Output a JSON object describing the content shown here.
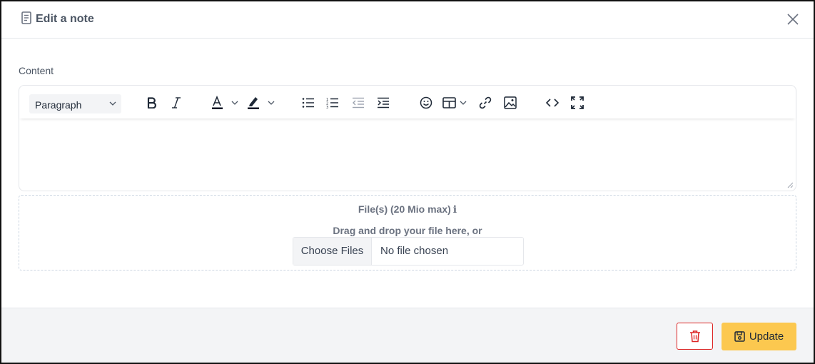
{
  "modal": {
    "title": "Edit a note",
    "title_icon": "note-icon",
    "close_icon": "close-icon"
  },
  "content_field": {
    "label": "Content",
    "editor_value": ""
  },
  "toolbar": {
    "block_format": "Paragraph",
    "buttons": [
      {
        "name": "bold-icon"
      },
      {
        "name": "italic-icon"
      },
      {
        "name": "text-color-icon"
      },
      {
        "name": "highlight-color-icon"
      },
      {
        "name": "bullet-list-icon"
      },
      {
        "name": "numbered-list-icon"
      },
      {
        "name": "outdent-icon"
      },
      {
        "name": "indent-icon"
      },
      {
        "name": "emoji-icon"
      },
      {
        "name": "table-icon"
      },
      {
        "name": "link-icon"
      },
      {
        "name": "image-icon"
      },
      {
        "name": "code-view-icon"
      },
      {
        "name": "fullscreen-icon"
      }
    ]
  },
  "upload": {
    "title": "File(s) (20 Mio max)",
    "info_icon": "i",
    "hint": "Drag and drop your file here, or",
    "choose_button": "Choose Files",
    "status": "No file chosen"
  },
  "footer": {
    "delete_icon": "trash-icon",
    "update_label": "Update",
    "update_icon": "save-icon"
  },
  "colors": {
    "update_bg": "#fcc84f",
    "delete_border": "#dc2626",
    "footer_bg": "#f3f4f6",
    "text_color_bar": "#111827"
  }
}
